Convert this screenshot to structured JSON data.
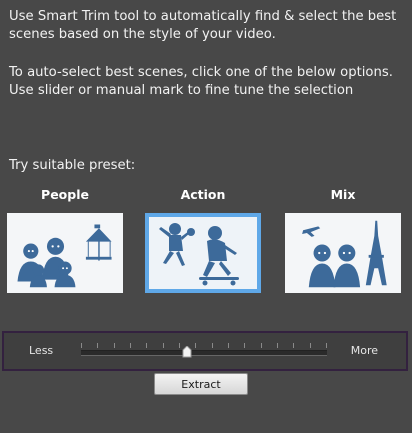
{
  "intro": {
    "line1": "Use Smart Trim tool to automatically find & select the best scenes based on the style of your video.",
    "line2": "To auto-select best scenes, click one of the below options. Use slider or manual mark to fine tune the selection"
  },
  "presets": {
    "label": "Try suitable preset:",
    "items": [
      {
        "title": "People",
        "selected": false
      },
      {
        "title": "Action",
        "selected": true
      },
      {
        "title": "Mix",
        "selected": false
      }
    ]
  },
  "slider": {
    "less_label": "Less",
    "more_label": "More",
    "value_fraction": 0.43,
    "tick_count": 16
  },
  "extract_label": "Extract",
  "colors": {
    "background": "#484848",
    "selected_border": "#5fa8e8",
    "illustration": "#3d6a9a",
    "slider_frame": "#33213f"
  }
}
